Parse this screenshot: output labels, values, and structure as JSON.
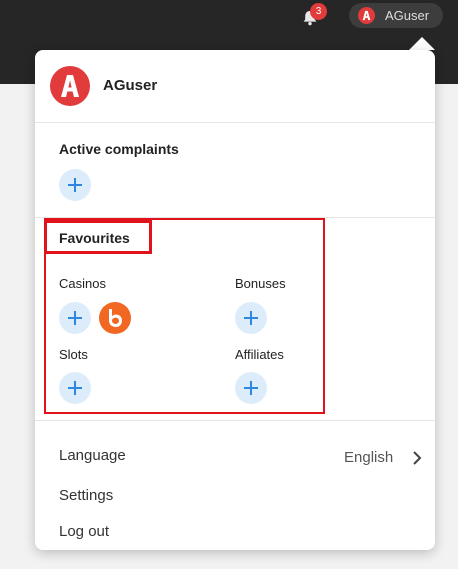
{
  "header": {
    "notification_count": "3",
    "username": "AGuser"
  },
  "dropdown": {
    "profile": {
      "username": "AGuser"
    },
    "active_complaints": {
      "title": "Active complaints"
    },
    "favourites": {
      "title": "Favourites",
      "casinos_label": "Casinos",
      "bonuses_label": "Bonuses",
      "slots_label": "Slots",
      "affiliates_label": "Affiliates"
    },
    "menu": {
      "language_label": "Language",
      "language_value": "English",
      "settings_label": "Settings",
      "logout_label": "Log out"
    }
  },
  "colors": {
    "brand_red": "#e23b3b",
    "add_button_bg": "#ddecfb",
    "add_button_icon": "#2e86de",
    "highlight_red": "#e0131c",
    "casino_logo_orange": "#f26722",
    "topbar": "#262626"
  },
  "icons": {
    "notification": "bell-icon",
    "avatar": "askgamblers-logo-icon",
    "add": "plus-icon",
    "casino_favourite": "b-casino-logo-icon",
    "language_arrow": "chevron-right-icon"
  }
}
